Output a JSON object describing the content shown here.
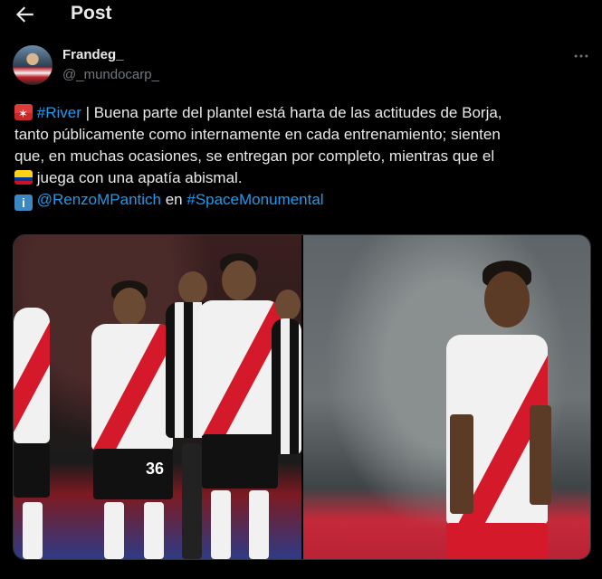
{
  "header": {
    "title": "Post"
  },
  "author": {
    "name": "Frandeg_",
    "handle": "@_mundocarp_"
  },
  "post": {
    "hashtag_river": "#River",
    "line1_rest": " | Buena parte del plantel está harta de las actitudes de Borja,",
    "line2": "tanto públicamente como internamente en cada entrenamiento; sienten",
    "line3": "que, en muchas ocasiones, se entregan por completo, mientras que el",
    "line4": " juega con una apatía abismal.",
    "mention": "@RenzoMPantich",
    "connector": " en ",
    "hashtag_space": "#SpaceMonumental"
  },
  "media": {
    "left_photo": {
      "jersey_number": "36"
    }
  },
  "colors": {
    "background": "#000000",
    "text": "#e7e9ea",
    "muted": "#71767b",
    "link": "#1d9bf0",
    "river_red": "#d3192a"
  },
  "icons": [
    "back-arrow-icon",
    "more-options-icon",
    "siren-emoji",
    "colombia-flag-emoji",
    "info-emoji"
  ]
}
